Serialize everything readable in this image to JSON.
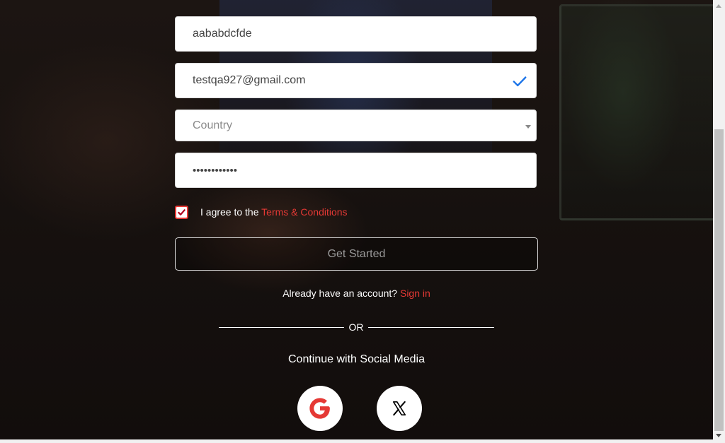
{
  "form": {
    "username_value": "aababdcfde",
    "email_value": "testqa927@gmail.com",
    "country_placeholder": "Country",
    "password_mask": "••••••••••••",
    "agree_prefix": "I agree to the",
    "terms_link": "Terms & Conditions",
    "submit_label": "Get Started"
  },
  "signin": {
    "prompt": "Already have an account?",
    "link": "Sign in"
  },
  "divider": {
    "text": "OR"
  },
  "social": {
    "heading": "Continue with Social Media",
    "providers": [
      {
        "name": "Google",
        "icon": "google-icon"
      },
      {
        "name": "X",
        "icon": "x-icon"
      }
    ]
  },
  "colors": {
    "accent": "#e53935",
    "valid_check": "#1a73e8"
  }
}
